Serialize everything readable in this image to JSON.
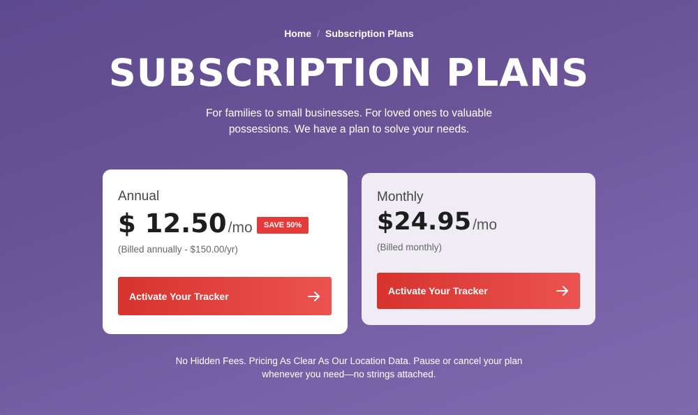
{
  "breadcrumb": {
    "home": "Home",
    "separator": "/",
    "current": "Subscription Plans"
  },
  "title": "SUBSCRIPTION PLANS",
  "subtitle": "For families to small businesses. For loved ones to valuable possessions. We have a plan to solve your needs.",
  "plans": [
    {
      "name": "Annual",
      "price": "$ 12.50",
      "per": "/mo",
      "badge": "SAVE 50%",
      "billed": "(Billed annually - $150.00/yr)",
      "cta": "Activate Your Tracker",
      "cta_icon": "arrow-right-icon"
    },
    {
      "name": "Monthly",
      "price": "$24.95",
      "per": "/mo",
      "billed": "(Billed monthly)",
      "cta": "Activate Your Tracker",
      "cta_icon": "arrow-right-icon"
    }
  ],
  "footnote": "No Hidden Fees. Pricing As Clear As Our Location Data. Pause or cancel your plan whenever you need—no strings attached.",
  "colors": {
    "background": "#6a5497",
    "accent": "#e53a3a",
    "card_annual": "#ffffff",
    "card_monthly": "#efecf4"
  }
}
